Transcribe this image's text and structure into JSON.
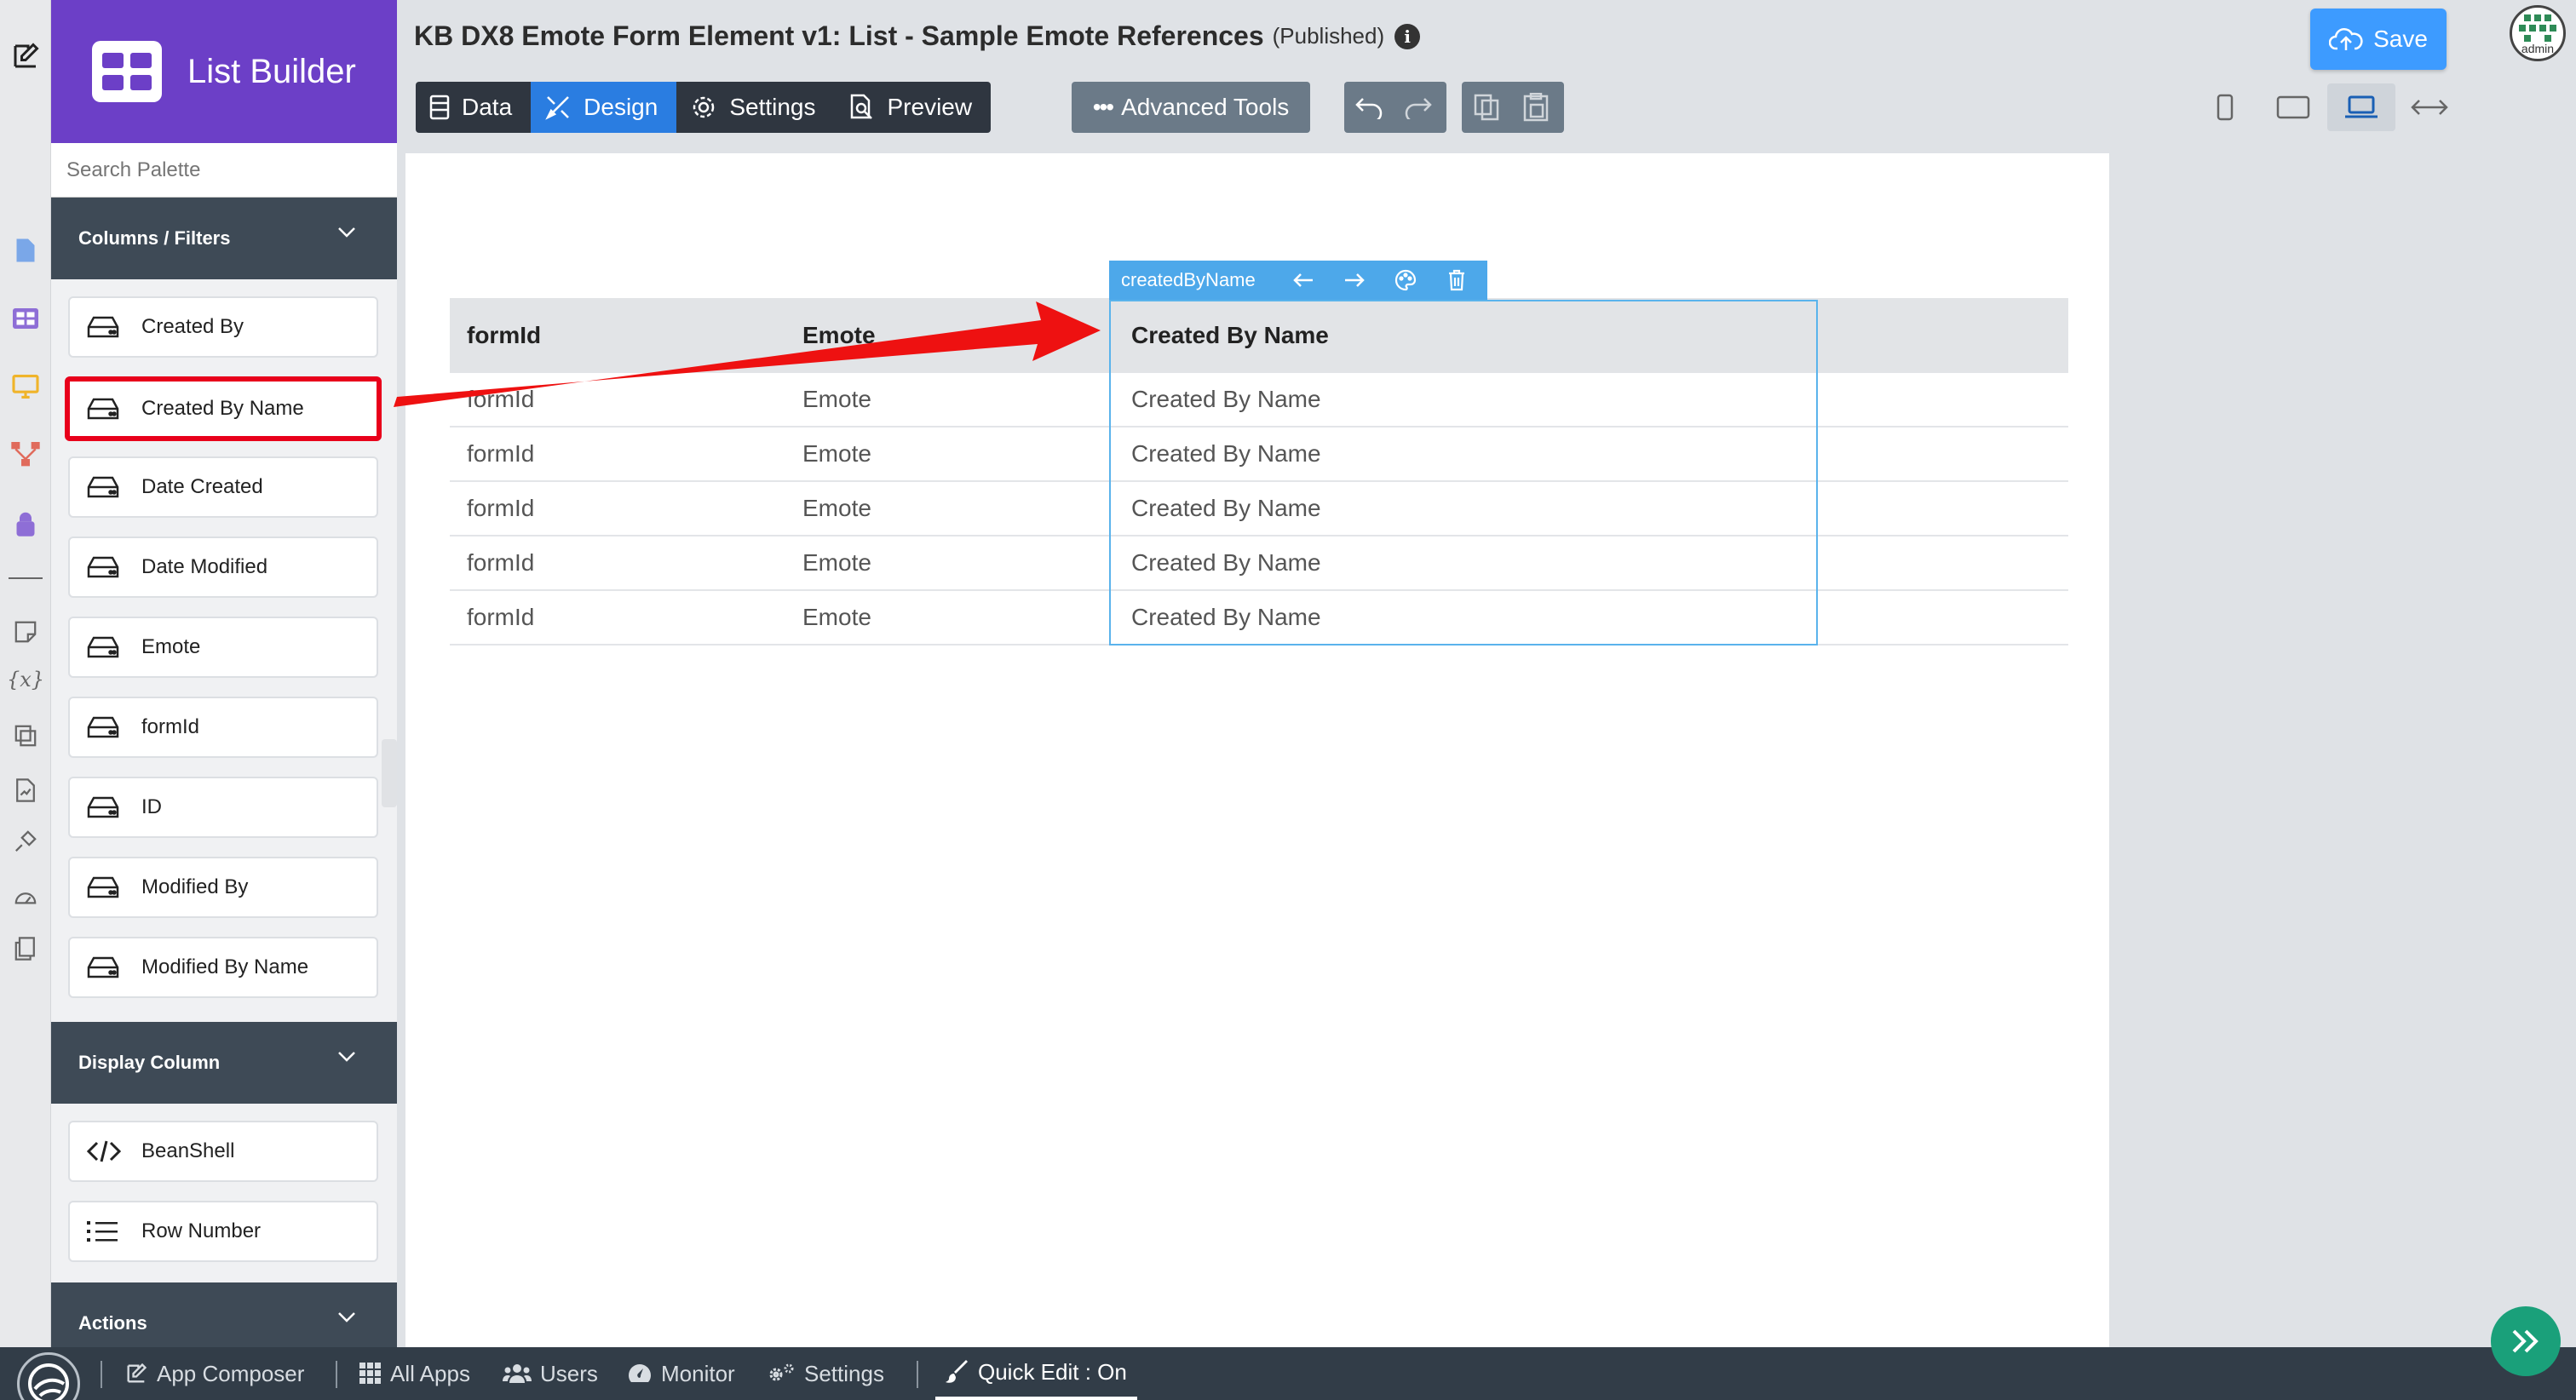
{
  "app": {
    "brand_name": "List Builder",
    "accent_color": "#6c3fc7",
    "page_title": "KB DX8 Emote Form Element v1: List - Sample Emote References",
    "status": "(Published)"
  },
  "palette": {
    "search_placeholder": "Search Palette",
    "sections": [
      {
        "title": "Columns / Filters",
        "items": [
          "Created By",
          "Created By Name",
          "Date Created",
          "Date Modified",
          "Emote",
          "formId",
          "ID",
          "Modified By",
          "Modified By Name"
        ]
      },
      {
        "title": "Display Column",
        "items": [
          "BeanShell",
          "Row Number"
        ]
      },
      {
        "title": "Actions",
        "items": []
      }
    ],
    "highlighted_item": "Created By Name"
  },
  "toolbar": {
    "tabs": [
      "Data",
      "Design",
      "Settings",
      "Preview"
    ],
    "active_tab": "Design",
    "advanced_tools": "Advanced Tools",
    "save_label": "Save",
    "avatar_label": "admin"
  },
  "canvas": {
    "selected_column": "createdByName",
    "columns": [
      "formId",
      "Emote",
      "Created By Name"
    ],
    "rows": [
      [
        "formId",
        "Emote",
        "Created By Name"
      ],
      [
        "formId",
        "Emote",
        "Created By Name"
      ],
      [
        "formId",
        "Emote",
        "Created By Name"
      ],
      [
        "formId",
        "Emote",
        "Created By Name"
      ],
      [
        "formId",
        "Emote",
        "Created By Name"
      ]
    ]
  },
  "bottom_bar": {
    "items": [
      "App Composer",
      "All Apps",
      "Users",
      "Monitor",
      "Settings",
      "Quick Edit : On"
    ]
  }
}
